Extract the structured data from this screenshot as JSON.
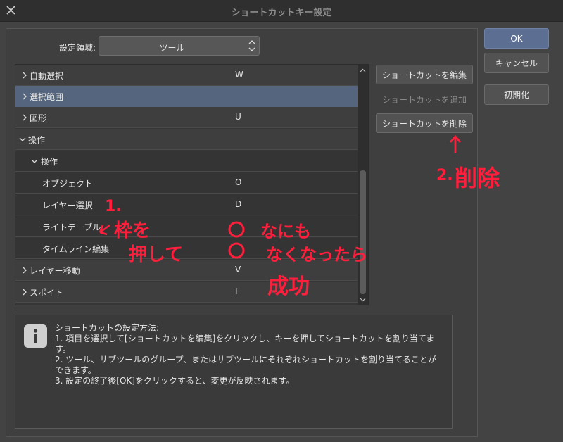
{
  "window": {
    "title": "ショートカットキー設定"
  },
  "settings_area": {
    "label": "設定領域:",
    "value": "ツール"
  },
  "tree": {
    "rows": [
      {
        "label": "自動選択",
        "key": "W"
      },
      {
        "label": "選択範囲",
        "key": ""
      },
      {
        "label": "図形",
        "key": "U"
      },
      {
        "label": "操作",
        "key": ""
      },
      {
        "label": "操作",
        "key": ""
      },
      {
        "label": "オブジェクト",
        "key": "O"
      },
      {
        "label": "レイヤー選択",
        "key": "D"
      },
      {
        "label": "ライトテーブル",
        "key": ""
      },
      {
        "label": "タイムライン編集",
        "key": ""
      },
      {
        "label": "レイヤー移動",
        "key": "V"
      },
      {
        "label": "スポイト",
        "key": "I"
      }
    ]
  },
  "actions": {
    "edit": "ショートカットを編集",
    "add": "ショートカットを追加",
    "delete": "ショートカットを削除"
  },
  "dialog_buttons": {
    "ok": "OK",
    "cancel": "キャンセル",
    "reset": "初期化"
  },
  "info": {
    "heading": "ショートカットの設定方法:",
    "steps": [
      "1. 項目を選択して[ショートカットを編集]をクリックし、キーを押してショートカットを割り当てます。",
      "2. ツール、サブツールのグループ、またはサブツールにそれぞれショートカットを割り当てることができます。",
      "3. 設定の終了後[OK]をクリックすると、変更が反映されます。"
    ]
  },
  "annotations": {
    "step1_number": "1.",
    "step1_text_a": "枠を",
    "step1_text_b": "押して",
    "step2_number": "2.",
    "step2_text": "削除",
    "result_line1": "なにも",
    "result_line2": "なくなったら",
    "result_line3": "成功"
  },
  "colors": {
    "accent": "#5c6f93",
    "selected_row": "#55657e",
    "annotation": "#ff1f3d"
  }
}
